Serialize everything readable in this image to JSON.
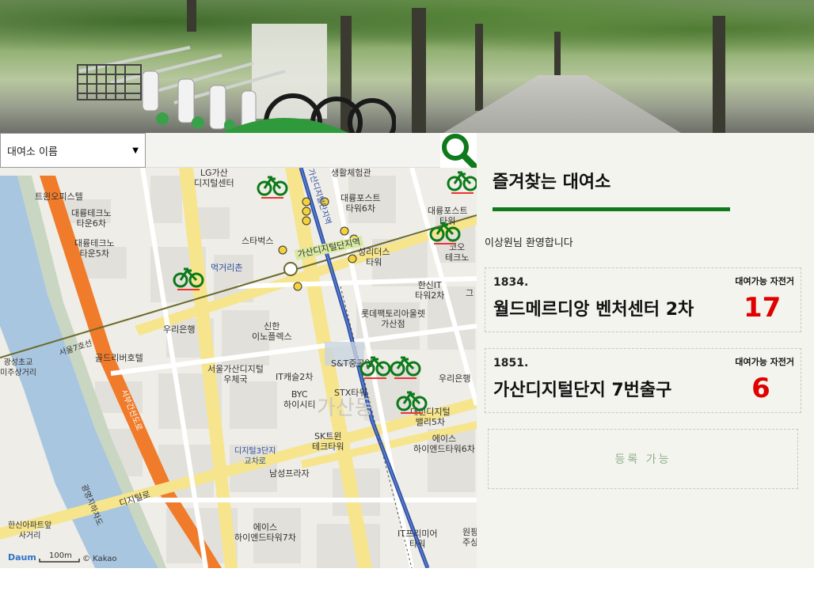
{
  "select": {
    "label": "대여소 이름"
  },
  "map": {
    "labels": [
      {
        "text": "LG가산\n디지털센터"
      },
      {
        "text": "생활체험관"
      },
      {
        "text": "트윈오피스텔"
      },
      {
        "text": "대륭포스트\n타워6차"
      },
      {
        "text": "대륭테크노\n타운6차"
      },
      {
        "text": "대륭포스트\n타워"
      },
      {
        "text": "대륭테크노\n타운5차"
      },
      {
        "text": "스타벅스"
      },
      {
        "text": "성리더스\n타워"
      },
      {
        "text": "코오\n테크노"
      },
      {
        "text": "먹거리촌"
      },
      {
        "text": "가산디지털단지역"
      },
      {
        "text": "한신IT\n타워2차"
      },
      {
        "text": "롯데팩토리아울렛\n가산점"
      },
      {
        "text": "우리은행"
      },
      {
        "text": "신한\n이노플렉스"
      },
      {
        "text": "골드리버호텔"
      },
      {
        "text": "서울가산디지털\n우체국"
      },
      {
        "text": "IT캐슬2차"
      },
      {
        "text": "S&T중공업"
      },
      {
        "text": "우리은행"
      },
      {
        "text": "BYC\n하이시티"
      },
      {
        "text": "STX타워"
      },
      {
        "text": "가산동"
      },
      {
        "text": "대신디지털\n밸리5차"
      },
      {
        "text": "SK트윈\n테크타워"
      },
      {
        "text": "에이스\n하이엔드타워6차"
      },
      {
        "text": "디지털3단지\n교차로"
      },
      {
        "text": "남성프라자"
      },
      {
        "text": "디지털로"
      },
      {
        "text": "에이스\n하이엔드타워7차"
      },
      {
        "text": "IT프리미어\n타워"
      },
      {
        "text": "원팡\n주상"
      },
      {
        "text": "한신아파트앞\n사거리"
      },
      {
        "text": "광성초교\n미주상거리"
      },
      {
        "text": "서부간선도로"
      },
      {
        "text": "광명지하차도"
      },
      {
        "text": "서울7호선"
      },
      {
        "text": "가산디지털단지역"
      },
      {
        "text": "그"
      },
      {
        "text": "100m"
      },
      {
        "text": "© Kakao"
      },
      {
        "text": "Daum"
      }
    ]
  },
  "panel": {
    "title": "즐겨찾는 대여소",
    "welcome": "이상원님 환영합니다",
    "favorites": [
      {
        "number": "1834.",
        "name": "월드메르디앙 벤처센터 2차",
        "avail_label": "대여가능 자전거",
        "count": "17"
      },
      {
        "number": "1851.",
        "name": "가산디지털단지 7번출구",
        "avail_label": "대여가능 자전거",
        "count": "6"
      }
    ],
    "register_label": "등록 가능"
  },
  "colors": {
    "accent": "#117a1c",
    "count": "#e00000",
    "register": "#8fae8f"
  }
}
